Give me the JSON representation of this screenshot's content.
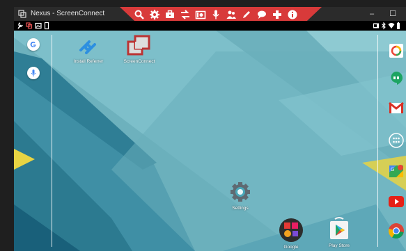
{
  "window": {
    "title": "Nexus - ScreenConnect",
    "minimize": "–",
    "maximize": "☐"
  },
  "toolbar": {
    "icons": [
      "search-icon",
      "gear-icon",
      "toolbox-icon",
      "swap-icon",
      "camera-icon",
      "microphone-icon",
      "user-group-icon",
      "pen-icon",
      "chat-icon",
      "plus-icon",
      "info-icon"
    ]
  },
  "desktop": {
    "icons": [
      {
        "label": "Install Referrer"
      },
      {
        "label": "ScreenConnect"
      },
      {
        "label": "Settings"
      },
      {
        "label": "Google"
      },
      {
        "label": "Play Store"
      }
    ]
  },
  "colors": {
    "toolbar": "#d83a3a",
    "title_bar": "#2b2b2b",
    "wallpaper_base": "#6fb2be"
  }
}
